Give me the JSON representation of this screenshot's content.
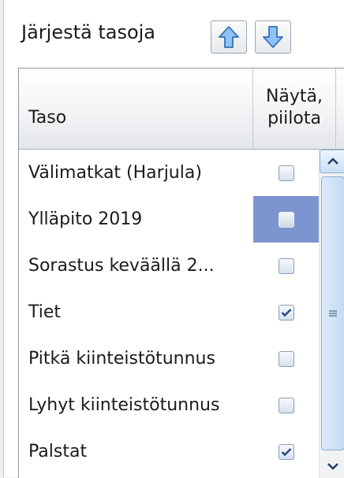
{
  "panel": {
    "title": "Järjestä tasoja",
    "move_up_icon": "arrow-up-icon",
    "move_down_icon": "arrow-down-icon"
  },
  "grid": {
    "columns": {
      "name": "Taso",
      "show_line1": "Näytä,",
      "show_line2": "piilota"
    },
    "rows": [
      {
        "name": "Välimatkat (Harjula)",
        "visible": false,
        "selected": false
      },
      {
        "name": "Ylläpito 2019",
        "visible": false,
        "selected": true
      },
      {
        "name": "Sorastus keväällä 2...",
        "visible": false,
        "selected": false
      },
      {
        "name": "Tiet",
        "visible": true,
        "selected": false
      },
      {
        "name": "Pitkä kiinteistötunnus",
        "visible": false,
        "selected": false
      },
      {
        "name": "Lyhyt kiinteistötunnus",
        "visible": false,
        "selected": false
      },
      {
        "name": "Palstat",
        "visible": true,
        "selected": false
      }
    ]
  },
  "colors": {
    "selection": "#7d95cf",
    "arrow_fill": "#8ec3f2",
    "arrow_stroke": "#3f7cc0",
    "checkmark": "#2c4f86"
  }
}
